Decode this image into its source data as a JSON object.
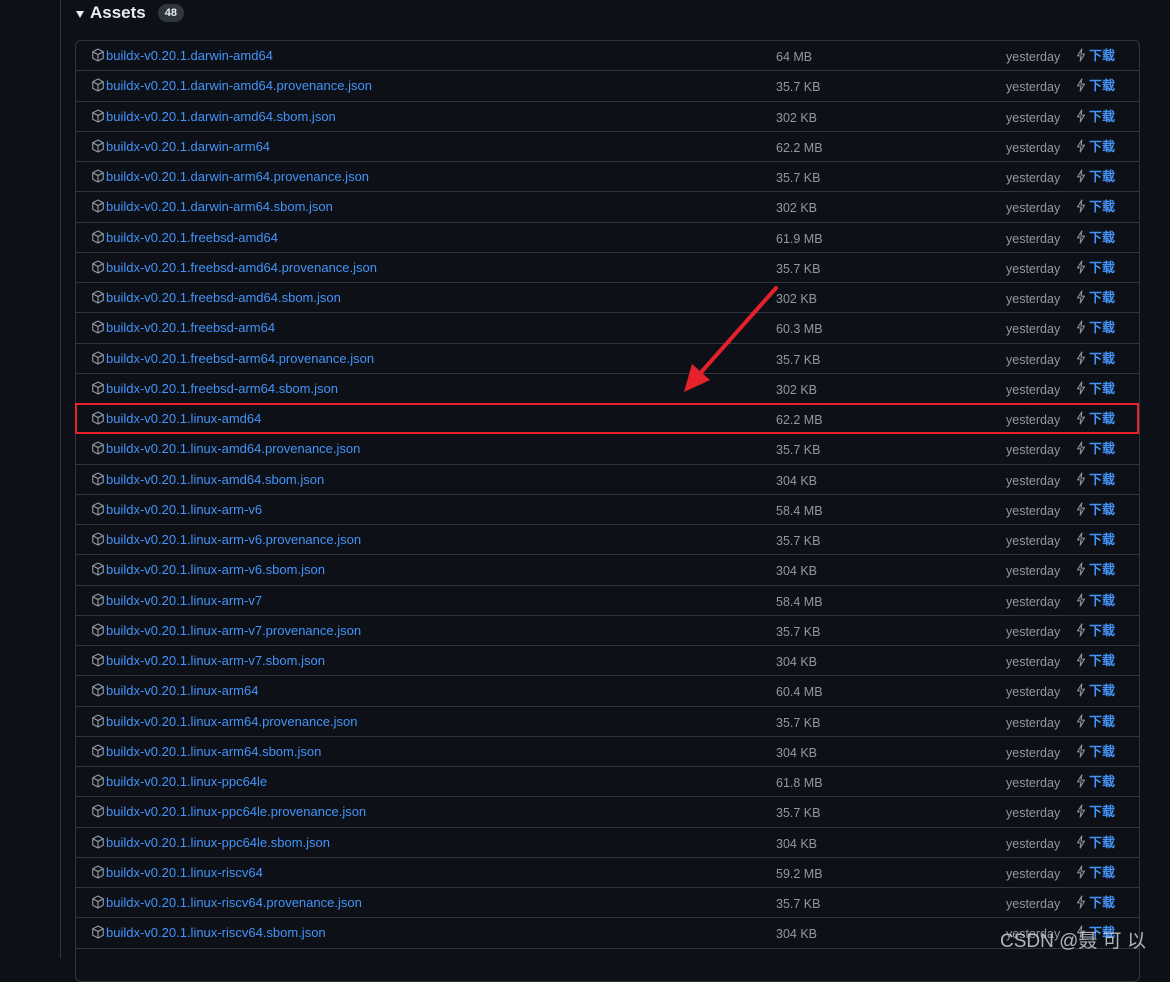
{
  "assets": {
    "title": "Assets",
    "count": "48",
    "download_label": "下载",
    "items": [
      {
        "name": "buildx-v0.20.1.darwin-amd64",
        "size": "64 MB",
        "date": "yesterday"
      },
      {
        "name": "buildx-v0.20.1.darwin-amd64.provenance.json",
        "size": "35.7 KB",
        "date": "yesterday"
      },
      {
        "name": "buildx-v0.20.1.darwin-amd64.sbom.json",
        "size": "302 KB",
        "date": "yesterday"
      },
      {
        "name": "buildx-v0.20.1.darwin-arm64",
        "size": "62.2 MB",
        "date": "yesterday"
      },
      {
        "name": "buildx-v0.20.1.darwin-arm64.provenance.json",
        "size": "35.7 KB",
        "date": "yesterday"
      },
      {
        "name": "buildx-v0.20.1.darwin-arm64.sbom.json",
        "size": "302 KB",
        "date": "yesterday"
      },
      {
        "name": "buildx-v0.20.1.freebsd-amd64",
        "size": "61.9 MB",
        "date": "yesterday"
      },
      {
        "name": "buildx-v0.20.1.freebsd-amd64.provenance.json",
        "size": "35.7 KB",
        "date": "yesterday"
      },
      {
        "name": "buildx-v0.20.1.freebsd-amd64.sbom.json",
        "size": "302 KB",
        "date": "yesterday"
      },
      {
        "name": "buildx-v0.20.1.freebsd-arm64",
        "size": "60.3 MB",
        "date": "yesterday"
      },
      {
        "name": "buildx-v0.20.1.freebsd-arm64.provenance.json",
        "size": "35.7 KB",
        "date": "yesterday"
      },
      {
        "name": "buildx-v0.20.1.freebsd-arm64.sbom.json",
        "size": "302 KB",
        "date": "yesterday"
      },
      {
        "name": "buildx-v0.20.1.linux-amd64",
        "size": "62.2 MB",
        "date": "yesterday",
        "highlighted": true
      },
      {
        "name": "buildx-v0.20.1.linux-amd64.provenance.json",
        "size": "35.7 KB",
        "date": "yesterday"
      },
      {
        "name": "buildx-v0.20.1.linux-amd64.sbom.json",
        "size": "304 KB",
        "date": "yesterday"
      },
      {
        "name": "buildx-v0.20.1.linux-arm-v6",
        "size": "58.4 MB",
        "date": "yesterday"
      },
      {
        "name": "buildx-v0.20.1.linux-arm-v6.provenance.json",
        "size": "35.7 KB",
        "date": "yesterday"
      },
      {
        "name": "buildx-v0.20.1.linux-arm-v6.sbom.json",
        "size": "304 KB",
        "date": "yesterday"
      },
      {
        "name": "buildx-v0.20.1.linux-arm-v7",
        "size": "58.4 MB",
        "date": "yesterday"
      },
      {
        "name": "buildx-v0.20.1.linux-arm-v7.provenance.json",
        "size": "35.7 KB",
        "date": "yesterday"
      },
      {
        "name": "buildx-v0.20.1.linux-arm-v7.sbom.json",
        "size": "304 KB",
        "date": "yesterday"
      },
      {
        "name": "buildx-v0.20.1.linux-arm64",
        "size": "60.4 MB",
        "date": "yesterday"
      },
      {
        "name": "buildx-v0.20.1.linux-arm64.provenance.json",
        "size": "35.7 KB",
        "date": "yesterday"
      },
      {
        "name": "buildx-v0.20.1.linux-arm64.sbom.json",
        "size": "304 KB",
        "date": "yesterday"
      },
      {
        "name": "buildx-v0.20.1.linux-ppc64le",
        "size": "61.8 MB",
        "date": "yesterday"
      },
      {
        "name": "buildx-v0.20.1.linux-ppc64le.provenance.json",
        "size": "35.7 KB",
        "date": "yesterday"
      },
      {
        "name": "buildx-v0.20.1.linux-ppc64le.sbom.json",
        "size": "304 KB",
        "date": "yesterday"
      },
      {
        "name": "buildx-v0.20.1.linux-riscv64",
        "size": "59.2 MB",
        "date": "yesterday"
      },
      {
        "name": "buildx-v0.20.1.linux-riscv64.provenance.json",
        "size": "35.7 KB",
        "date": "yesterday"
      },
      {
        "name": "buildx-v0.20.1.linux-riscv64.sbom.json",
        "size": "304 KB",
        "date": "yesterday"
      }
    ]
  },
  "watermark": "CSDN @聂 可 以",
  "colors": {
    "background": "#0d1117",
    "border": "#30363d",
    "link": "#4493f8",
    "muted": "#9198a1",
    "annotation": "#e5212b"
  },
  "icons": {
    "package": "package-icon",
    "download": "zap-icon",
    "caret": "triangle-down-icon"
  }
}
